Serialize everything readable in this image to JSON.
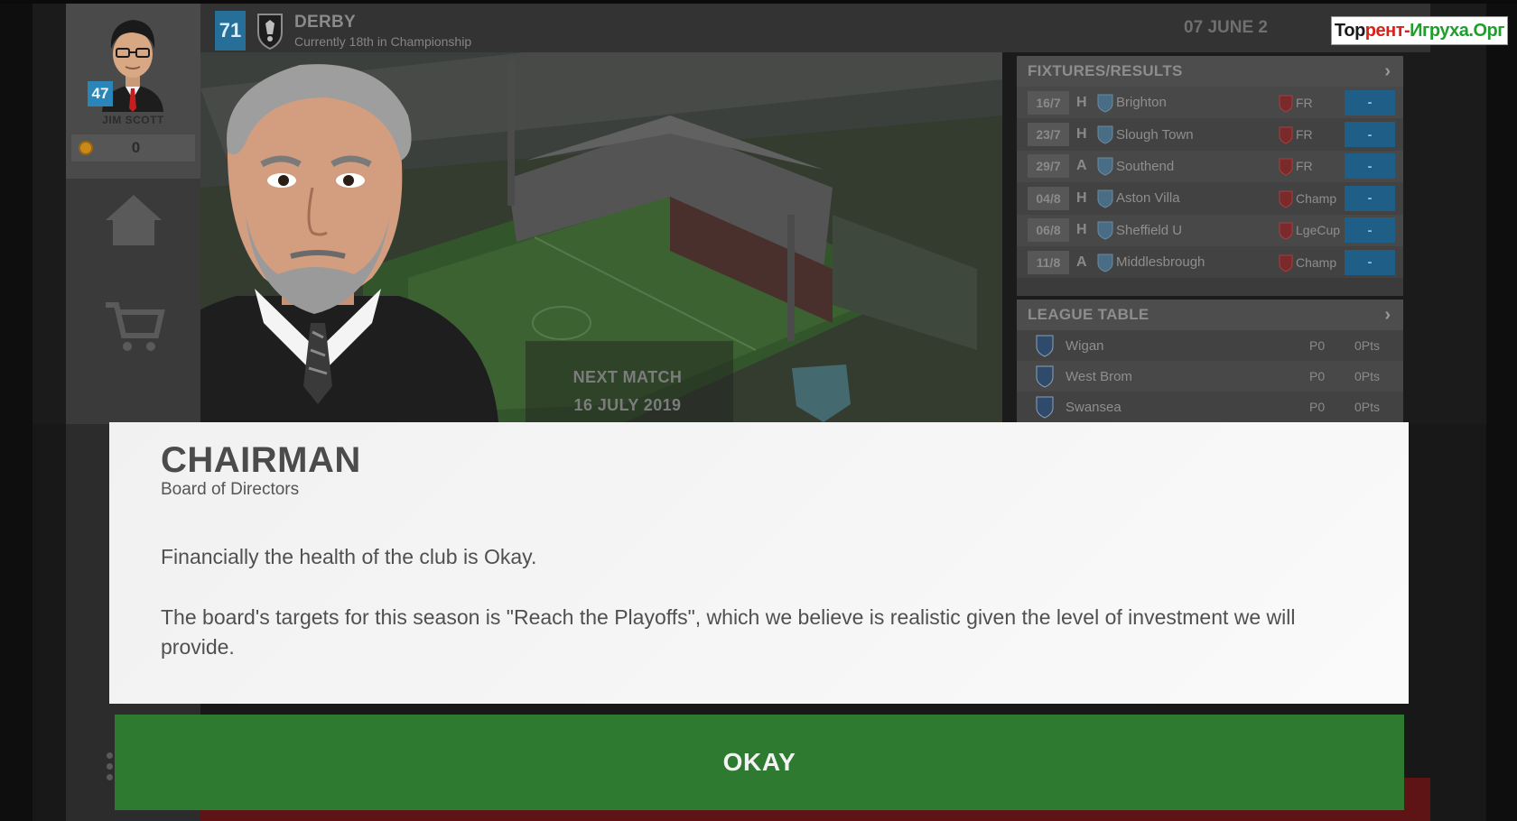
{
  "manager": {
    "level": "47",
    "name": "JIM SCOTT",
    "coins": "0"
  },
  "club": {
    "rating": "71",
    "name": "DERBY",
    "status": "Currently 18th in Championship"
  },
  "game_date": "07 JUNE 2",
  "watermark": {
    "part1": "Тор",
    "part2": "рент-",
    "part3": "Игруха.Орг"
  },
  "next_match": {
    "label": "NEXT MATCH",
    "date": "16 JULY 2019"
  },
  "fixtures": {
    "title": "FIXTURES/RESULTS",
    "rows": [
      {
        "date": "16/7",
        "venue": "H",
        "team": "Brighton",
        "comp": "FR",
        "result": "-"
      },
      {
        "date": "23/7",
        "venue": "H",
        "team": "Slough Town",
        "comp": "FR",
        "result": "-"
      },
      {
        "date": "29/7",
        "venue": "A",
        "team": "Southend",
        "comp": "FR",
        "result": "-"
      },
      {
        "date": "04/8",
        "venue": "H",
        "team": "Aston Villa",
        "comp": "Champ",
        "result": "-"
      },
      {
        "date": "06/8",
        "venue": "H",
        "team": "Sheffield U",
        "comp": "LgeCup",
        "result": "-"
      },
      {
        "date": "11/8",
        "venue": "A",
        "team": "Middlesbrough",
        "comp": "Champ",
        "result": "-"
      }
    ]
  },
  "league_table": {
    "title": "LEAGUE TABLE",
    "rows": [
      {
        "team": "Wigan",
        "played": "P0",
        "points": "0Pts"
      },
      {
        "team": "West Brom",
        "played": "P0",
        "points": "0Pts"
      },
      {
        "team": "Swansea",
        "played": "P0",
        "points": "0Pts"
      }
    ]
  },
  "modal": {
    "title": "CHAIRMAN",
    "subtitle": "Board of Directors",
    "paragraph1": "Financially the health of the club is Okay.",
    "paragraph2": "The board's targets for this season is \"Reach the Playoffs\", which we believe is realistic given the level of investment we will provide.",
    "button": "OKAY"
  },
  "colors": {
    "accent_blue": "#256f98",
    "okay_green": "#2e7a31",
    "modal_bg": "#f4f4f4",
    "panel_bg": "#3b3b3b"
  },
  "icons": [
    "home-icon",
    "cart-icon",
    "club-crest-icon",
    "coin-icon",
    "chevron-right-icon"
  ]
}
